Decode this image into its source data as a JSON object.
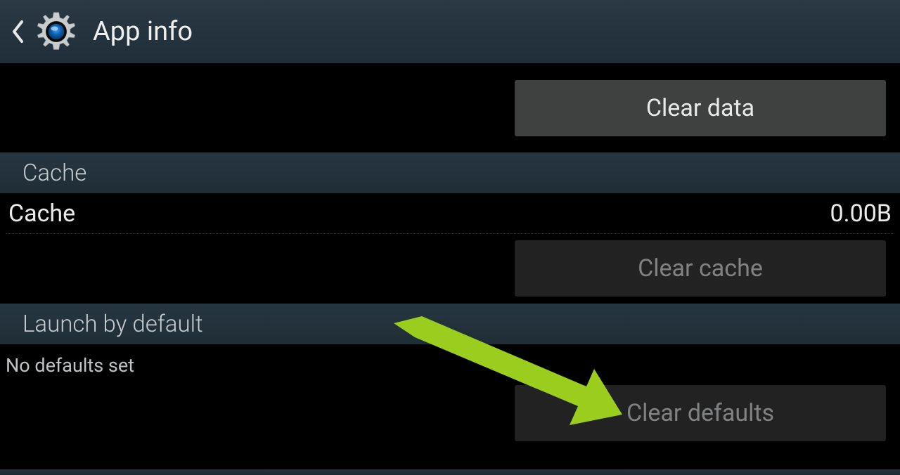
{
  "header": {
    "title": "App info"
  },
  "buttons": {
    "clear_data": "Clear data",
    "clear_cache": "Clear cache",
    "clear_defaults": "Clear defaults"
  },
  "sections": {
    "cache": "Cache",
    "launch_by_default": "Launch by default"
  },
  "cache": {
    "label": "Cache",
    "value": "0.00B"
  },
  "defaults": {
    "status": "No defaults set"
  },
  "arrow": {
    "color": "#9ACD1E"
  }
}
